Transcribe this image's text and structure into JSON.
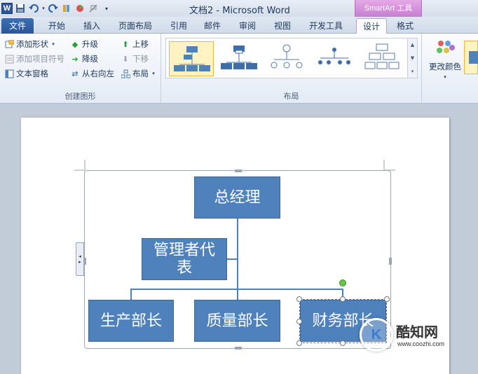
{
  "window": {
    "title": "文档2 - Microsoft Word",
    "context_tab_group": "SmartArt 工具"
  },
  "quick_access": {
    "app_icon_letter": "W",
    "icons": [
      "word-icon",
      "save-icon",
      "undo-icon",
      "redo-icon",
      "format-painter-icon",
      "color-icon",
      "clear-format-icon",
      "customize-dropdown-icon"
    ]
  },
  "ribbon_tabs": [
    {
      "label": "文件"
    },
    {
      "label": "开始"
    },
    {
      "label": "插入"
    },
    {
      "label": "页面布局"
    },
    {
      "label": "引用"
    },
    {
      "label": "邮件"
    },
    {
      "label": "审阅"
    },
    {
      "label": "视图"
    },
    {
      "label": "开发工具"
    },
    {
      "label": "设计"
    },
    {
      "label": "格式"
    }
  ],
  "active_tab": "设计",
  "groups": {
    "create": {
      "label": "创建图形",
      "add_shape": "添加形状",
      "add_bullet": "添加项目符号",
      "text_pane": "文本窗格",
      "promote": "升级",
      "demote": "降级",
      "right_to_left": "从右向左",
      "move_up": "上移",
      "move_down": "下移",
      "layout": "布局"
    },
    "layouts": {
      "label": "布局"
    },
    "colors": {
      "change_colors": "更改颜色"
    }
  },
  "diagram": {
    "top": "总经理",
    "assistant": "管理者代表",
    "children": [
      "生产部长",
      "质量部长",
      "财务部长"
    ]
  },
  "watermark": {
    "name": "酷知网",
    "url": "www.coozhi.com",
    "logo_letter": "K"
  },
  "colors": {
    "node_fill": "#4f81bd",
    "ribbon_file_tab": "#2a5699",
    "context_tab": "#c77dd0"
  }
}
